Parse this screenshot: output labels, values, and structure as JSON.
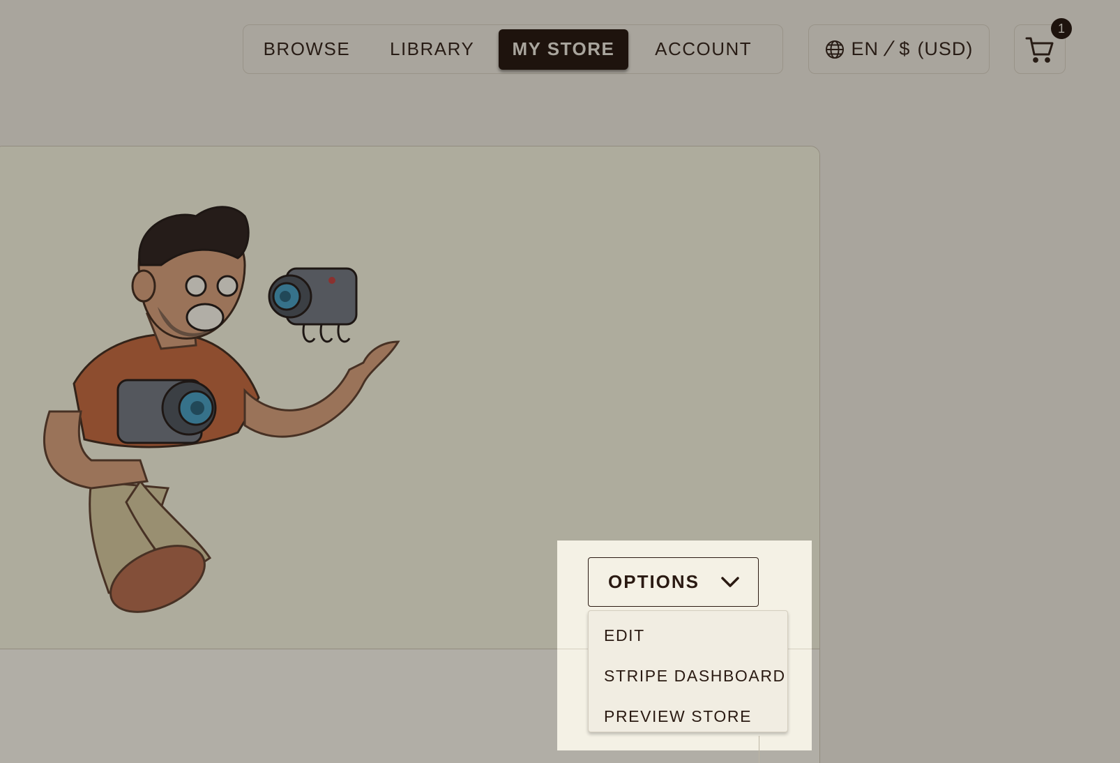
{
  "nav": {
    "items": [
      {
        "label": "BROWSE"
      },
      {
        "label": "LIBRARY"
      },
      {
        "label": "MY STORE",
        "active": true
      },
      {
        "label": "ACCOUNT"
      }
    ]
  },
  "locale": {
    "language": "EN",
    "separator": "/",
    "currency_symbol": "$",
    "currency_code": "(USD)",
    "icon": "globe-icon"
  },
  "cart": {
    "icon": "cart-icon",
    "count": "1"
  },
  "store": {
    "illustration": "photographer-with-cameras-illustration"
  },
  "options_menu": {
    "button_label": "OPTIONS",
    "icon": "chevron-down-icon",
    "items": [
      {
        "label": "EDIT"
      },
      {
        "label": "STRIPE DASHBOARD"
      },
      {
        "label": "PREVIEW STORE"
      }
    ]
  },
  "colors": {
    "background": "#f2efe6",
    "primary_dark": "#1a0b05",
    "overlay": "rgba(40,34,28,0.36)"
  }
}
